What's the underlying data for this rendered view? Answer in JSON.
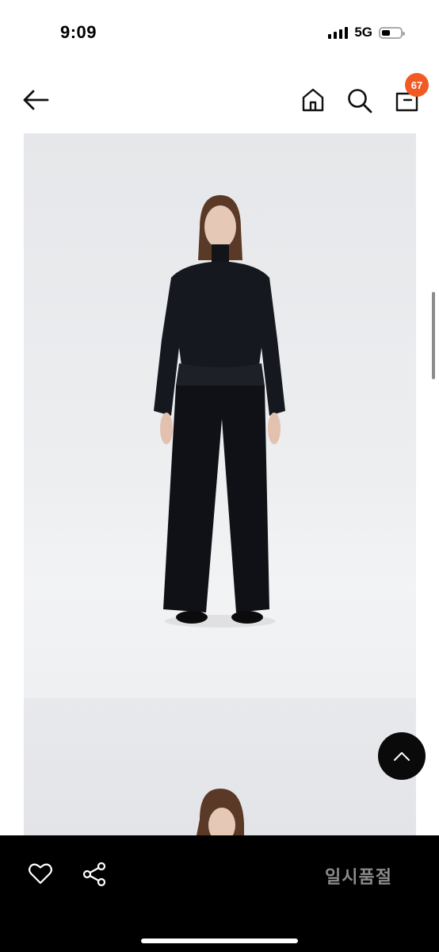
{
  "status_bar": {
    "time": "9:09",
    "network": "5G",
    "battery_level": 0.45
  },
  "header": {
    "cart_count": "67",
    "icons": [
      "back-arrow-icon",
      "home-icon",
      "search-icon",
      "shopping-bag-icon"
    ]
  },
  "footer": {
    "soldout_label": "일시품절",
    "icons": [
      "heart-icon",
      "share-icon"
    ]
  },
  "floating": {
    "icon": "chevron-up-icon"
  },
  "colors": {
    "badge": "#f15a22",
    "bottom_bar": "#000000",
    "soldout_text": "#8a8a8a",
    "photo_bg": "#e9eaec"
  }
}
